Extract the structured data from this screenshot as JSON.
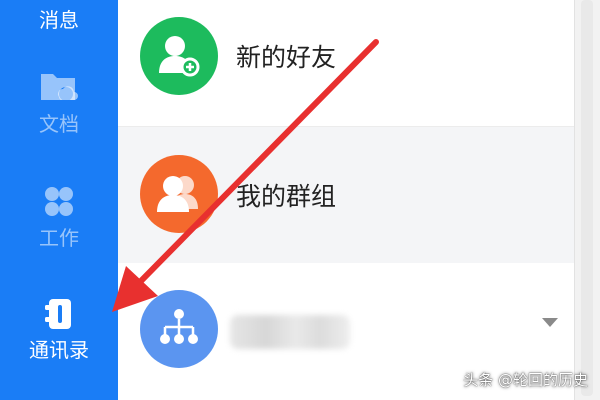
{
  "nav": {
    "messages_label": "消息",
    "docs_label": "文档",
    "work_label": "工作",
    "contacts_label": "通讯录",
    "active": "contacts",
    "bg_color": "#1a7df6"
  },
  "list": {
    "rows": [
      {
        "label": "新的好友",
        "icon": "add-friend-icon",
        "color": "#1dbb5d"
      },
      {
        "label": "我的群组",
        "icon": "group-icon",
        "color": "#f4692d"
      },
      {
        "label": "",
        "icon": "org-chart-icon",
        "color": "#5b95f0",
        "name_blurred": true
      }
    ]
  },
  "annotation": {
    "arrow_color": "#e8302f"
  },
  "watermark": "头条 @轮回的历史"
}
